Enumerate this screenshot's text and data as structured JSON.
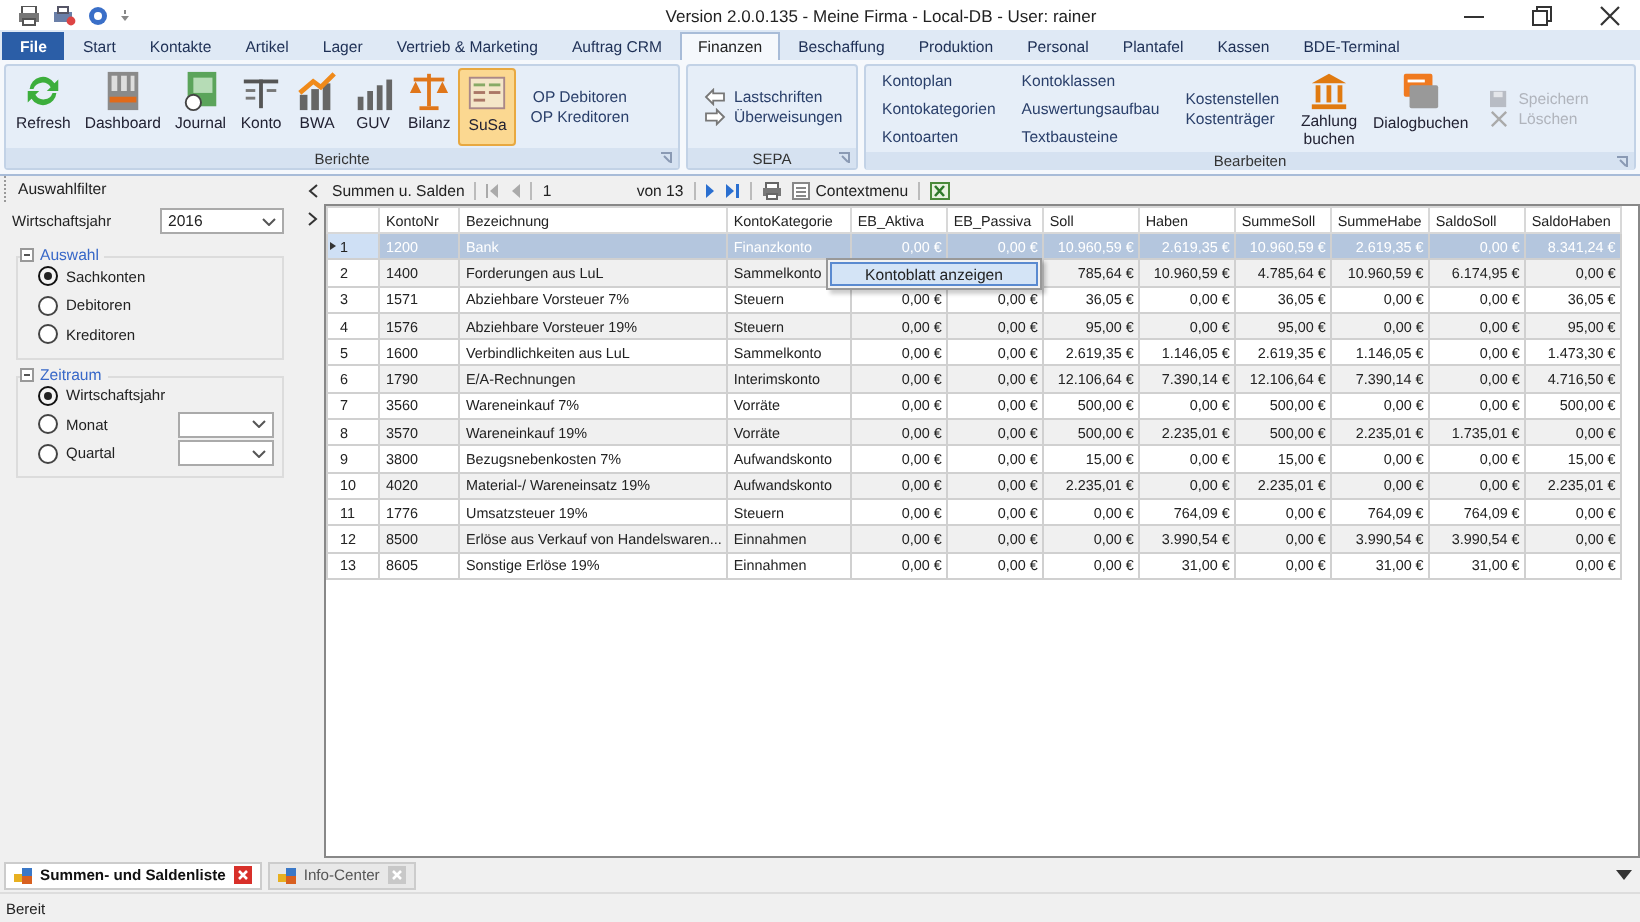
{
  "window": {
    "title": "Version 2.0.0.135 - Meine Firma - Local-DB - User: rainer"
  },
  "menu_tabs": [
    {
      "label": "File",
      "kind": "file"
    },
    {
      "label": "Start",
      "kind": "tab",
      "selected": false
    },
    {
      "label": "Kontakte",
      "kind": "tab",
      "selected": false
    },
    {
      "label": "Artikel",
      "kind": "tab",
      "selected": false
    },
    {
      "label": "Lager",
      "kind": "tab",
      "selected": false
    },
    {
      "label": "Vertrieb & Marketing",
      "kind": "tab",
      "selected": false
    },
    {
      "label": "Auftrag CRM",
      "kind": "tab",
      "selected": false
    },
    {
      "label": "Finanzen",
      "kind": "tab",
      "selected": true
    },
    {
      "label": "Beschaffung",
      "kind": "tab",
      "selected": false
    },
    {
      "label": "Produktion",
      "kind": "tab",
      "selected": false
    },
    {
      "label": "Personal",
      "kind": "tab",
      "selected": false
    },
    {
      "label": "Plantafel",
      "kind": "tab",
      "selected": false
    },
    {
      "label": "Kassen",
      "kind": "tab",
      "selected": false
    },
    {
      "label": "BDE-Terminal",
      "kind": "tab",
      "selected": false
    }
  ],
  "ribbon": {
    "groups": [
      {
        "label": "Berichte",
        "items": [
          {
            "kind": "large",
            "label": "Refresh",
            "selected": false
          },
          {
            "kind": "large",
            "label": "Dashboard",
            "selected": false
          },
          {
            "kind": "large",
            "label": "Journal",
            "selected": false
          },
          {
            "kind": "large",
            "label": "Konto",
            "selected": false
          },
          {
            "kind": "large",
            "label": "BWA",
            "selected": false
          },
          {
            "kind": "large",
            "label": "GUV",
            "selected": false
          },
          {
            "kind": "large",
            "label": "Bilanz",
            "selected": false
          },
          {
            "kind": "large",
            "label": "SuSa",
            "selected": true
          },
          {
            "kind": "stack",
            "entries": [
              {
                "label": "OP Debitoren",
                "disabled": false
              },
              {
                "label": "OP Kreditoren",
                "disabled": false
              }
            ]
          }
        ]
      },
      {
        "label": "SEPA",
        "items": [
          {
            "kind": "icon-stack",
            "entries": [
              {
                "label": "Lastschriften",
                "disabled": false
              },
              {
                "label": "Überweisungen",
                "disabled": false
              }
            ]
          }
        ]
      },
      {
        "label": "Bearbeiten",
        "items": [
          {
            "kind": "stack",
            "entries": [
              {
                "label": "Kontoplan",
                "disabled": false
              },
              {
                "label": "Kontokategorien",
                "disabled": false
              },
              {
                "label": "Kontoarten",
                "disabled": false
              }
            ]
          },
          {
            "kind": "stack",
            "entries": [
              {
                "label": "Kontoklassen",
                "disabled": false
              },
              {
                "label": "Auswertungsaufbau",
                "disabled": false
              },
              {
                "label": "Textbausteine",
                "disabled": false
              }
            ]
          },
          {
            "kind": "stack",
            "entries": [
              {
                "label": "Kostenstellen",
                "disabled": false
              },
              {
                "label": "Kostenträger",
                "disabled": false
              }
            ]
          },
          {
            "kind": "large",
            "label": "Zahlung buchen",
            "selected": false
          },
          {
            "kind": "large",
            "label": "Dialogbuchen",
            "selected": false
          },
          {
            "kind": "icon-stack",
            "entries": [
              {
                "label": "Speichern",
                "disabled": true
              },
              {
                "label": "Löschen",
                "disabled": true
              }
            ]
          }
        ]
      }
    ]
  },
  "filter_panel": {
    "title": "Auswahlfilter",
    "fiscal_year": {
      "label": "Wirtschaftsjahr",
      "value": "2016"
    },
    "sections": [
      {
        "title": "Auswahl",
        "expanded": true,
        "options": [
          {
            "label": "Sachkonten",
            "kind": "radio",
            "selected": true
          },
          {
            "label": "Debitoren",
            "kind": "radio",
            "selected": false
          },
          {
            "label": "Kreditoren",
            "kind": "radio",
            "selected": false
          }
        ]
      },
      {
        "title": "Zeitraum",
        "expanded": true,
        "options": [
          {
            "label": "Wirtschaftsjahr",
            "kind": "radio",
            "selected": true
          },
          {
            "label": "Monat",
            "kind": "radio-dropdown",
            "selected": false
          },
          {
            "label": "Quartal",
            "kind": "radio-dropdown",
            "selected": false
          }
        ]
      }
    ]
  },
  "grid_toolbar": {
    "title": "Summen u. Salden",
    "page": "1",
    "page_count": "von 13",
    "context_menu_label": "Contextmenu"
  },
  "table": {
    "columns": [
      "KontoNr",
      "Bezeichnung",
      "KontoKategorie",
      "EB_Aktiva",
      "EB_Passiva",
      "Soll",
      "Haben",
      "SummeSoll",
      "SummeHabe",
      "SaldoSoll",
      "SaldoHaben"
    ],
    "rows": [
      {
        "selected": true,
        "number": "1",
        "cells": [
          "1200",
          "Bank",
          "Finanzkonto",
          "0,00 €",
          "0,00 €",
          "10.960,59 €",
          "2.619,35 €",
          "10.960,59 €",
          "2.619,35 €",
          "0,00 €",
          "8.341,24 €"
        ]
      },
      {
        "selected": false,
        "number": "2",
        "cells": [
          "1400",
          "Forderungen aus LuL",
          "Sammelkonto",
          null,
          null,
          "785,64 €",
          "10.960,59 €",
          "4.785,64 €",
          "10.960,59 €",
          "6.174,95 €",
          "0,00 €"
        ]
      },
      {
        "selected": false,
        "number": "3",
        "cells": [
          "1571",
          "Abziehbare Vorsteuer 7%",
          "Steuern",
          "0,00 €",
          "0,00 €",
          "36,05 €",
          "0,00 €",
          "36,05 €",
          "0,00 €",
          "0,00 €",
          "36,05 €"
        ]
      },
      {
        "selected": false,
        "number": "4",
        "cells": [
          "1576",
          "Abziehbare Vorsteuer 19%",
          "Steuern",
          "0,00 €",
          "0,00 €",
          "95,00 €",
          "0,00 €",
          "95,00 €",
          "0,00 €",
          "0,00 €",
          "95,00 €"
        ]
      },
      {
        "selected": false,
        "number": "5",
        "cells": [
          "1600",
          "Verbindlichkeiten aus LuL",
          "Sammelkonto",
          "0,00 €",
          "0,00 €",
          "2.619,35 €",
          "1.146,05 €",
          "2.619,35 €",
          "1.146,05 €",
          "0,00 €",
          "1.473,30 €"
        ]
      },
      {
        "selected": false,
        "number": "6",
        "cells": [
          "1790",
          "E/A-Rechnungen",
          "Interimskonto",
          "0,00 €",
          "0,00 €",
          "12.106,64 €",
          "7.390,14 €",
          "12.106,64 €",
          "7.390,14 €",
          "0,00 €",
          "4.716,50 €"
        ]
      },
      {
        "selected": false,
        "number": "7",
        "cells": [
          "3560",
          "Wareneinkauf 7%",
          "Vorräte",
          "0,00 €",
          "0,00 €",
          "500,00 €",
          "0,00 €",
          "500,00 €",
          "0,00 €",
          "0,00 €",
          "500,00 €"
        ]
      },
      {
        "selected": false,
        "number": "8",
        "cells": [
          "3570",
          "Wareneinkauf 19%",
          "Vorräte",
          "0,00 €",
          "0,00 €",
          "500,00 €",
          "2.235,01 €",
          "500,00 €",
          "2.235,01 €",
          "1.735,01 €",
          "0,00 €"
        ]
      },
      {
        "selected": false,
        "number": "9",
        "cells": [
          "3800",
          "Bezugsnebenkosten 7%",
          "Aufwandskonto",
          "0,00 €",
          "0,00 €",
          "15,00 €",
          "0,00 €",
          "15,00 €",
          "0,00 €",
          "0,00 €",
          "15,00 €"
        ]
      },
      {
        "selected": false,
        "number": "10",
        "cells": [
          "4020",
          "Material-/ Wareneinsatz 19%",
          "Aufwandskonto",
          "0,00 €",
          "0,00 €",
          "2.235,01 €",
          "0,00 €",
          "2.235,01 €",
          "0,00 €",
          "0,00 €",
          "2.235,01 €"
        ]
      },
      {
        "selected": false,
        "number": "11",
        "cells": [
          "1776",
          "Umsatzsteuer 19%",
          "Steuern",
          "0,00 €",
          "0,00 €",
          "0,00 €",
          "764,09 €",
          "0,00 €",
          "764,09 €",
          "764,09 €",
          "0,00 €"
        ]
      },
      {
        "selected": false,
        "number": "12",
        "cells": [
          "8500",
          "Erlöse aus Verkauf von Handelswaren...",
          "Einnahmen",
          "0,00 €",
          "0,00 €",
          "0,00 €",
          "3.990,54 €",
          "0,00 €",
          "3.990,54 €",
          "3.990,54 €",
          "0,00 €"
        ]
      },
      {
        "selected": false,
        "number": "13",
        "cells": [
          "8605",
          "Sonstige Erlöse 19%",
          "Einnahmen",
          "0,00 €",
          "0,00 €",
          "0,00 €",
          "31,00 €",
          "0,00 €",
          "31,00 €",
          "31,00 €",
          "0,00 €"
        ]
      }
    ]
  },
  "context_menu": {
    "items": [
      {
        "label": "Kontoblatt anzeigen",
        "selected": true
      }
    ]
  },
  "document_tabs": [
    {
      "label": "Summen- und Saldenliste",
      "selected": true
    },
    {
      "label": "Info-Center",
      "selected": false
    }
  ],
  "status_bar": {
    "text": "Bereit"
  }
}
